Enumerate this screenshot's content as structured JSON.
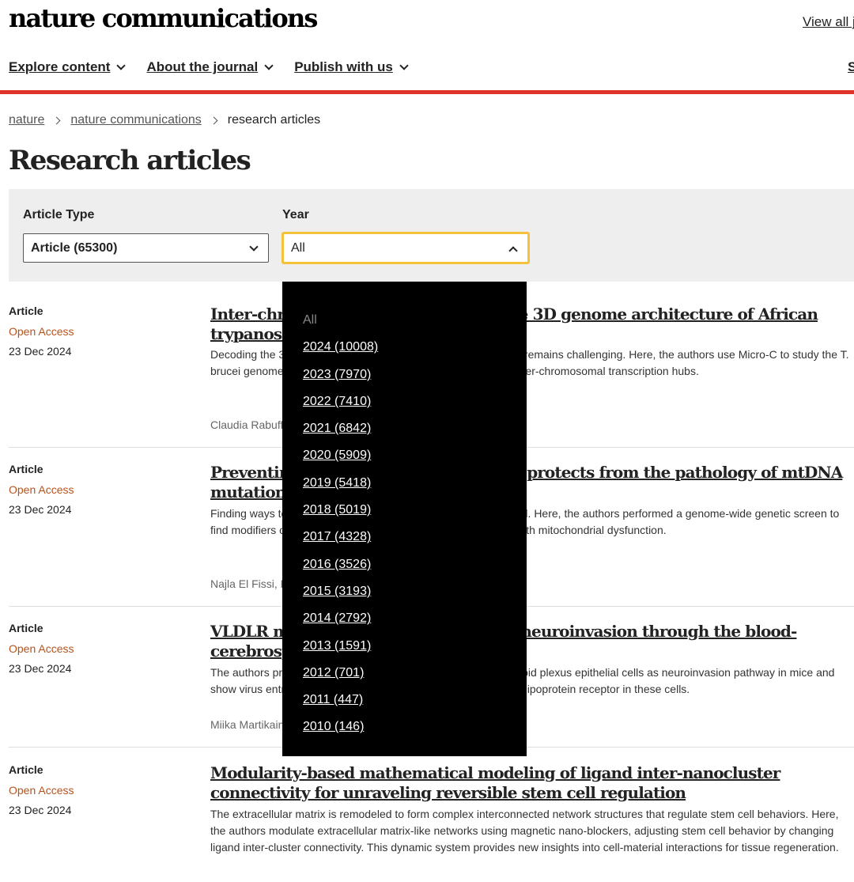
{
  "header": {
    "logo": "nature communications",
    "view_all": "View all j",
    "nav": [
      {
        "label": "Explore content"
      },
      {
        "label": "About the journal"
      },
      {
        "label": "Publish with us"
      }
    ],
    "nav_right": "S"
  },
  "breadcrumb": {
    "items": [
      "nature",
      "nature communications"
    ],
    "current": "research articles"
  },
  "page_title": "Research articles",
  "filters": {
    "article_type_label": "Article Type",
    "article_type_value": "Article (65300)",
    "year_label": "Year",
    "year_value": "All"
  },
  "year_dropdown": {
    "options": [
      "All",
      "2024 (10008)",
      "2023 (7970)",
      "2022 (7410)",
      "2021 (6842)",
      "2020 (5909)",
      "2019 (5418)",
      "2018 (5019)",
      "2017 (4328)",
      "2016 (3526)",
      "2015 (3193)",
      "2014 (2792)",
      "2013 (1591)",
      "2012 (701)",
      "2011 (447)",
      "2010 (146)"
    ]
  },
  "articles": [
    {
      "type": "Article",
      "access": "Open Access",
      "date": "23 Dec 2024",
      "title": "Inter-chromosomal contacts shape the 3D genome architecture of African trypanosomes",
      "description": "Decoding the 3D genome organization of African trypanosomes remains challenging. Here, the authors use Micro-C to study the T. brucei genome architecture and reveal an intricate network of inter-chromosomal transcription hubs.",
      "authors": "Claudia Rabuffo"
    },
    {
      "type": "Article",
      "access": "Open Access",
      "date": "23 Dec 2024",
      "title": "Preventing mitochondrial dysfunction protects from the pathology of mtDNA mutations in Drosophila",
      "description": "Finding ways to counteract mitochondrial dysfunction is essential. Here, the authors performed a genome-wide genetic screen to find modifiers of the behavioural phenotype of a fruit fly model with mitochondrial dysfunction.",
      "authors": "Najla El Fissi, F"
    },
    {
      "type": "Article",
      "access": "Open Access",
      "date": "23 Dec 2024",
      "title": "VLDLR mediates Semliki Forest virus neuroinvasion through the blood-cerebrospinal fluid barrier",
      "description": "The authors propose the blood-cerebrospinal fluid barrier's choroid plexus epithelial cells as neuroinvasion pathway in mice and show virus entry depends on the expression of very low-density-lipoprotein receptor in these cells.",
      "authors": "Miika Martikainen"
    },
    {
      "type": "Article",
      "access": "Open Access",
      "date": "23 Dec 2024",
      "title": "Modularity-based mathematical modeling of ligand inter-nanocluster connectivity for unraveling reversible stem cell regulation",
      "description": "The extracellular matrix is remodeled to form complex interconnected network structures that regulate stem cell behaviors. Here, the authors modulate extracellular matrix-like networks using magnetic nano-blockers, adjusting stem cell behavior by changing ligand inter-cluster connectivity. This dynamic system provides new insights into cell-material interactions for tissue regeneration.",
      "authors": ""
    }
  ]
}
